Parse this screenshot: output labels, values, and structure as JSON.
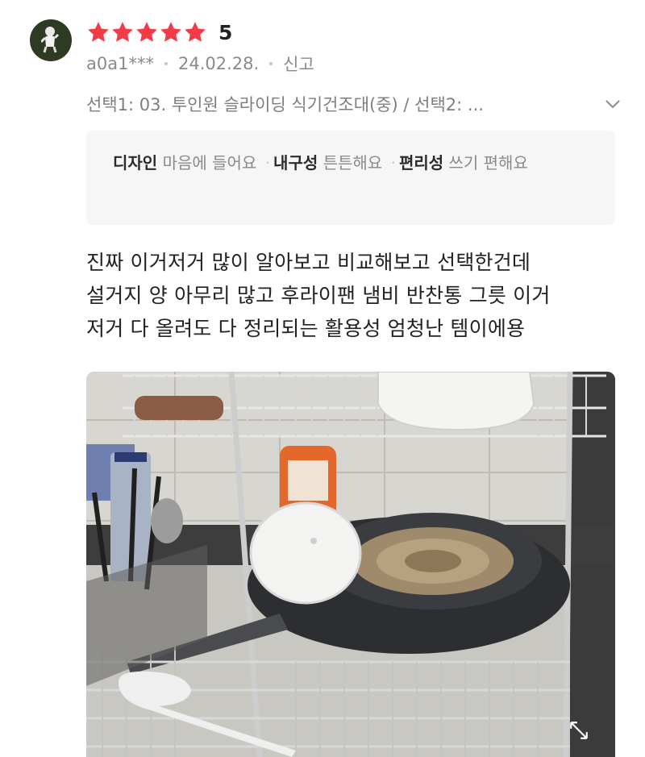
{
  "review": {
    "rating": "5",
    "star_count": 5,
    "star_color": "#f23b47",
    "user_id": "a0a1***",
    "date": "24.02.28.",
    "report_label": "신고",
    "option_text": "선택1: 03. 투인원 슬라이딩 식기건조대(중) / 선택2: ...",
    "attributes": [
      {
        "name": "디자인",
        "value": "마음에 들어요"
      },
      {
        "name": "내구성",
        "value": "튼튼해요"
      },
      {
        "name": "편리성",
        "value": "쓰기 편해요"
      }
    ],
    "body_lines": [
      "진짜 이거저거 많이 알아보고 비교해보고 선택한건데",
      "설거지 양 아무리 많고 후라이팬 냄비 반찬통 그릇 이거",
      "저거 다 올려도 다 정리되는 활용성 엄청난 템이에용"
    ],
    "photo": {
      "description_icon": "expand-icon"
    }
  }
}
